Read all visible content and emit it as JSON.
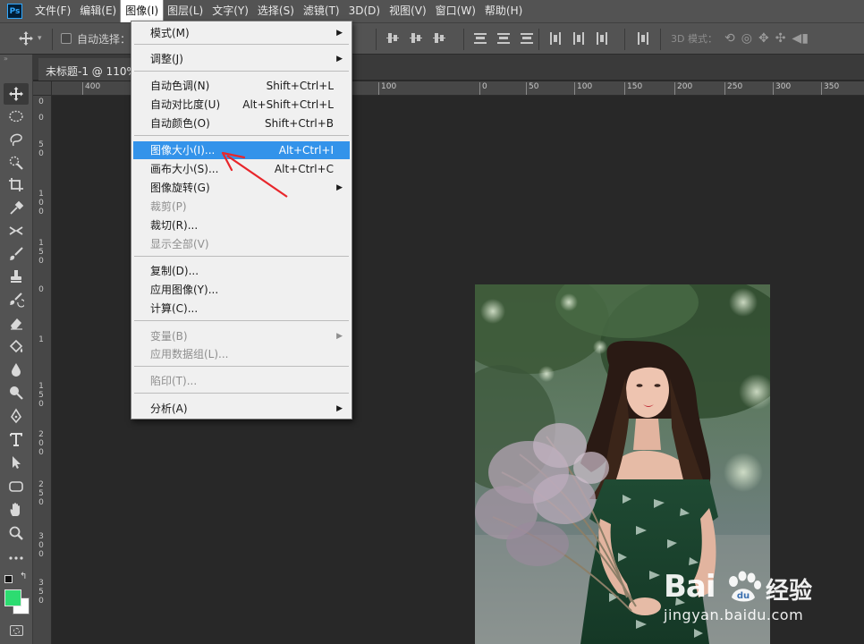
{
  "app": {
    "logo": "Ps"
  },
  "menubar": [
    "文件(F)",
    "编辑(E)",
    "图像(I)",
    "图层(L)",
    "文字(Y)",
    "选择(S)",
    "滤镜(T)",
    "3D(D)",
    "视图(V)",
    "窗口(W)",
    "帮助(H)"
  ],
  "optionsbar": {
    "auto_select_label": "自动选择：",
    "mode_3d_label": "3D 模式："
  },
  "document": {
    "tab_title": "未标题-1 @ 110%"
  },
  "rulers": {
    "horizontal": [
      "400",
      "100",
      "0",
      "50",
      "100",
      "150",
      "200",
      "250",
      "300",
      "350"
    ],
    "vertical": [
      "0",
      "0",
      "5 0",
      "1 0 0",
      "1 5 0",
      "0",
      "1",
      "1 5 0",
      "2 0 0",
      "2 5 0",
      "3 0 0",
      "3 5 0"
    ]
  },
  "image_menu": {
    "items": [
      {
        "label": "模式(M)",
        "shortcut": "",
        "submenu": true,
        "disabled": false
      },
      {
        "label": "调整(J)",
        "shortcut": "",
        "submenu": true,
        "disabled": false
      },
      {
        "label": "自动色调(N)",
        "shortcut": "Shift+Ctrl+L",
        "submenu": false,
        "disabled": false
      },
      {
        "label": "自动对比度(U)",
        "shortcut": "Alt+Shift+Ctrl+L",
        "submenu": false,
        "disabled": false
      },
      {
        "label": "自动颜色(O)",
        "shortcut": "Shift+Ctrl+B",
        "submenu": false,
        "disabled": false
      },
      {
        "label": "图像大小(I)...",
        "shortcut": "Alt+Ctrl+I",
        "submenu": false,
        "disabled": false,
        "highlighted": true
      },
      {
        "label": "画布大小(S)...",
        "shortcut": "Alt+Ctrl+C",
        "submenu": false,
        "disabled": false
      },
      {
        "label": "图像旋转(G)",
        "shortcut": "",
        "submenu": true,
        "disabled": false
      },
      {
        "label": "裁剪(P)",
        "shortcut": "",
        "submenu": false,
        "disabled": true
      },
      {
        "label": "裁切(R)...",
        "shortcut": "",
        "submenu": false,
        "disabled": false
      },
      {
        "label": "显示全部(V)",
        "shortcut": "",
        "submenu": false,
        "disabled": true
      },
      {
        "label": "复制(D)...",
        "shortcut": "",
        "submenu": false,
        "disabled": false
      },
      {
        "label": "应用图像(Y)...",
        "shortcut": "",
        "submenu": false,
        "disabled": false
      },
      {
        "label": "计算(C)...",
        "shortcut": "",
        "submenu": false,
        "disabled": false
      },
      {
        "label": "变量(B)",
        "shortcut": "",
        "submenu": true,
        "disabled": true
      },
      {
        "label": "应用数据组(L)...",
        "shortcut": "",
        "submenu": false,
        "disabled": true
      },
      {
        "label": "陷印(T)...",
        "shortcut": "",
        "submenu": false,
        "disabled": true
      },
      {
        "label": "分析(A)",
        "shortcut": "",
        "submenu": true,
        "disabled": false
      }
    ]
  },
  "watermark": {
    "brand": "Bai",
    "brand_cn": "经验",
    "url": "jingyan.baidu.com"
  },
  "colors": {
    "foreground": "#2ddc71",
    "background": "#ffffff",
    "highlight": "#3393ea",
    "annotation": "#e8262b"
  },
  "toolbox": {
    "tools": [
      "move-tool",
      "marquee-tool",
      "lasso-tool",
      "quick-select-tool",
      "crop-tool",
      "eyedropper-tool",
      "healing-tool",
      "brush-tool",
      "stamp-tool",
      "history-brush-tool",
      "eraser-tool",
      "paint-bucket-tool",
      "blur-tool",
      "dodge-tool",
      "pen-tool",
      "type-tool",
      "path-select-tool",
      "shape-tool",
      "hand-tool",
      "zoom-tool",
      "more-tools"
    ]
  }
}
